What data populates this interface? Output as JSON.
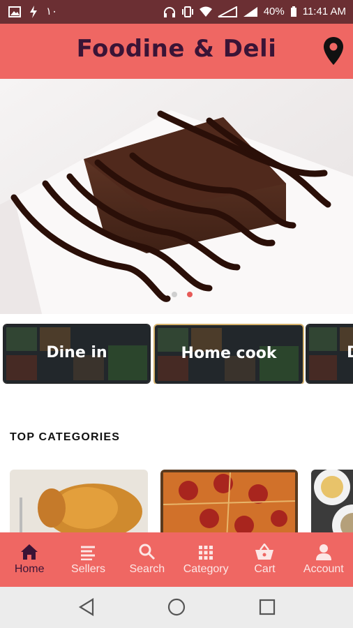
{
  "status_bar": {
    "left_text": "١٠",
    "battery": "40%",
    "time": "11:41 AM"
  },
  "app_title": "Foodine & Deli",
  "carousel": {
    "slide_count": 2,
    "active_index": 1
  },
  "quick_chips": [
    {
      "label": "Dine in"
    },
    {
      "label": "Home cook"
    },
    {
      "label": "D"
    }
  ],
  "section_title": "TOP CATEGORIES",
  "categories": [
    {
      "image": "roast-chicken"
    },
    {
      "image": "pepperoni-pizza"
    },
    {
      "image": "dishes"
    }
  ],
  "bottom_nav": [
    {
      "label": "Home",
      "icon": "home-icon",
      "active": true
    },
    {
      "label": "Sellers",
      "icon": "list-icon",
      "active": false
    },
    {
      "label": "Search",
      "icon": "search-icon",
      "active": false
    },
    {
      "label": "Category",
      "icon": "grid-icon",
      "active": false
    },
    {
      "label": "Cart",
      "icon": "basket-icon",
      "active": false
    },
    {
      "label": "Account",
      "icon": "person-icon",
      "active": false
    }
  ],
  "colors": {
    "primary": "#ef6763",
    "status_bar": "#6b2f33",
    "title": "#3a1436"
  }
}
